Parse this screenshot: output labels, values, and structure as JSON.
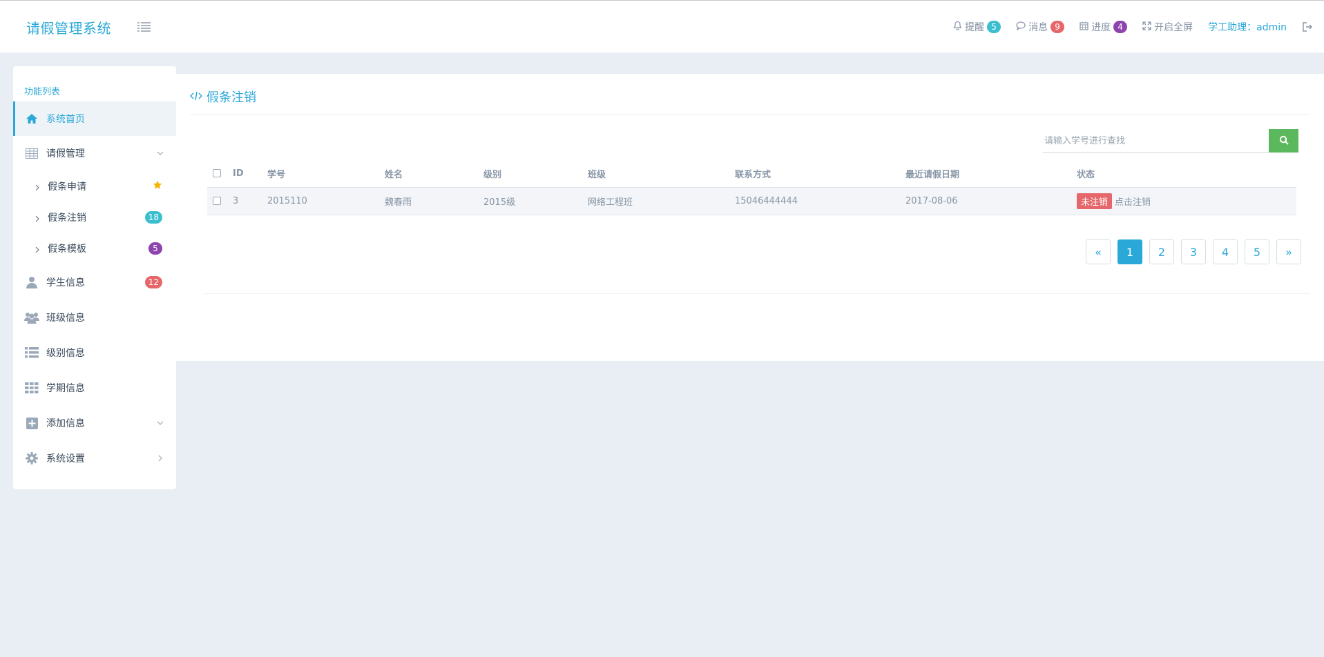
{
  "header": {
    "brand": "请假管理系统",
    "alerts": {
      "label": "提醒",
      "count": "5",
      "color": "#3bbfcf"
    },
    "messages": {
      "label": "消息",
      "count": "9",
      "color": "#e6676b"
    },
    "progress": {
      "label": "进度",
      "count": "4",
      "color": "#8e44ad"
    },
    "fullscreen": "开启全屏",
    "user": "学工助理：admin"
  },
  "sidebar": {
    "title": "功能列表",
    "items": [
      {
        "label": "系统首页",
        "icon": "home-icon"
      },
      {
        "label": "请假管理",
        "icon": "table-icon"
      },
      {
        "label": "学生信息",
        "icon": "user-icon",
        "count": "12"
      },
      {
        "label": "班级信息",
        "icon": "group-icon"
      },
      {
        "label": "级别信息",
        "icon": "list-icon"
      },
      {
        "label": "学期信息",
        "icon": "grid-icon"
      },
      {
        "label": "添加信息",
        "icon": "plus-square-icon"
      },
      {
        "label": "系统设置",
        "icon": "gear-icon"
      }
    ],
    "subitems": [
      {
        "label": "假条申请",
        "icon": "star-icon"
      },
      {
        "label": "假条注销",
        "count": "18"
      },
      {
        "label": "假条模板",
        "count": "5"
      }
    ]
  },
  "main": {
    "title": "假条注销",
    "search_placeholder": "请输入学号进行查找",
    "columns": [
      "ID",
      "学号",
      "姓名",
      "级别",
      "班级",
      "联系方式",
      "最近请假日期",
      "状态"
    ],
    "rows": [
      {
        "id": "3",
        "student_no": "2015110",
        "name": "魏春雨",
        "level": "2015级",
        "class": "网络工程班",
        "phone": "15046444444",
        "date": "2017-08-06",
        "status": "未注销",
        "action": "点击注销"
      }
    ],
    "pagination": {
      "prev": "«",
      "pages": [
        "1",
        "2",
        "3",
        "4",
        "5"
      ],
      "next": "»",
      "current": "1"
    }
  },
  "colors": {
    "accent": "#2aa8d8",
    "success": "#5cb85c",
    "danger": "#e6676b",
    "background": "#e9edf4"
  }
}
